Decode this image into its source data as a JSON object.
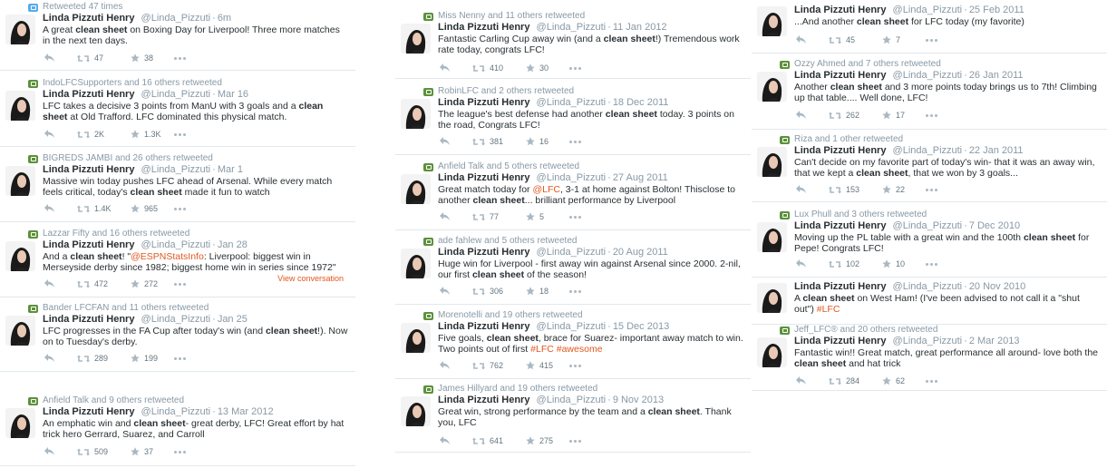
{
  "columns": [
    [
      {
        "rt": "Retweeted 47 times",
        "rtColor": "blue",
        "name": "Linda Pizzuti Henry",
        "handle": "@Linda_Pizzuti",
        "time": "6m",
        "text": [
          [
            "A great ",
            0
          ],
          [
            "clean sheet",
            1
          ],
          [
            " on Boxing Day for Liverpool! Three more matches in the next ten days.",
            0
          ]
        ],
        "retweets": "47",
        "favorites": "38"
      },
      {
        "rt": "IndoLFCSupporters and 16 others retweeted",
        "name": "Linda Pizzuti Henry",
        "handle": "@Linda_Pizzuti",
        "time": "Mar 16",
        "text": [
          [
            "LFC takes a decisive 3 points from ManU with 3 goals and a ",
            0
          ],
          [
            "clean sheet",
            1
          ],
          [
            " at Old Trafford. LFC dominated this physical match.",
            0
          ]
        ],
        "retweets": "2K",
        "favorites": "1.3K"
      },
      {
        "rt": "BIGREDS JAMBI and 26 others retweeted",
        "name": "Linda Pizzuti Henry",
        "handle": "@Linda_Pizzuti",
        "time": "Mar 1",
        "text": [
          [
            "Massive win today pushes LFC ahead of Arsenal. While every match feels critical, today's ",
            0
          ],
          [
            "clean sheet",
            1
          ],
          [
            " made it fun to watch",
            0
          ]
        ],
        "retweets": "1.4K",
        "favorites": "965"
      },
      {
        "rt": "Lazzar Fifty and 16 others retweeted",
        "name": "Linda Pizzuti Henry",
        "handle": "@Linda_Pizzuti",
        "time": "Jan 28",
        "text": [
          [
            "And a ",
            0
          ],
          [
            "clean sheet",
            1
          ],
          [
            "! \"",
            0
          ],
          [
            "@ESPNStatsInfo",
            2
          ],
          [
            ": Liverpool: biggest win in Merseyside derby since 1982; biggest home win in series since 1972\"",
            0
          ]
        ],
        "retweets": "472",
        "favorites": "272",
        "viewConversation": "View conversation"
      },
      {
        "rt": "Bander LFCFAN and 11 others retweeted",
        "name": "Linda Pizzuti Henry",
        "handle": "@Linda_Pizzuti",
        "time": "Jan 25",
        "text": [
          [
            "LFC progresses in the FA Cup after today's win (and ",
            0
          ],
          [
            "clean sheet",
            1
          ],
          [
            "!). Now on to Tuesday's derby.",
            0
          ]
        ],
        "retweets": "289",
        "favorites": "199"
      },
      {
        "rt": "Anfield Talk and 9 others retweeted",
        "name": "Linda Pizzuti Henry",
        "handle": "@Linda_Pizzuti",
        "time": "13 Mar 2012",
        "text": [
          [
            "An emphatic win and ",
            0
          ],
          [
            "clean sheet",
            1
          ],
          [
            "- great derby, LFC! Great effort by hat trick hero Gerrard, Suarez, and Carroll",
            0
          ]
        ],
        "retweets": "509",
        "favorites": "37"
      }
    ],
    [
      {
        "rt": "Miss Nenny and 11 others retweeted",
        "name": "Linda Pizzuti Henry",
        "handle": "@Linda_Pizzuti",
        "time": "11 Jan 2012",
        "text": [
          [
            "Fantastic Carling Cup away win (and a ",
            0
          ],
          [
            "clean sheet",
            1
          ],
          [
            "!) Tremendous work rate today, congrats LFC!",
            0
          ]
        ],
        "retweets": "410",
        "favorites": "30"
      },
      {
        "rt": "RobinLFC and 2 others retweeted",
        "name": "Linda Pizzuti Henry",
        "handle": "@Linda_Pizzuti",
        "time": "18 Dec 2011",
        "text": [
          [
            "The league's best defense had another ",
            0
          ],
          [
            "clean sheet",
            1
          ],
          [
            " today. 3 points on the road, Congrats LFC!",
            0
          ]
        ],
        "retweets": "381",
        "favorites": "16"
      },
      {
        "rt": "Anfield Talk and 5 others retweeted",
        "name": "Linda Pizzuti Henry",
        "handle": "@Linda_Pizzuti",
        "time": "27 Aug 2011",
        "text": [
          [
            "Great match today for ",
            0
          ],
          [
            "@LFC",
            2
          ],
          [
            ", 3-1 at home against Bolton! Thisclose to another ",
            0
          ],
          [
            "clean sheet",
            1
          ],
          [
            "... brilliant performance by Liverpool",
            0
          ]
        ],
        "retweets": "77",
        "favorites": "5"
      },
      {
        "rt": "ade fahlew and 5 others retweeted",
        "name": "Linda Pizzuti Henry",
        "handle": "@Linda_Pizzuti",
        "time": "20 Aug 2011",
        "text": [
          [
            "Huge win for Liverpool - first away win against Arsenal since 2000. 2-nil, our first ",
            0
          ],
          [
            "clean sheet",
            1
          ],
          [
            " of the season!",
            0
          ]
        ],
        "retweets": "306",
        "favorites": "18"
      },
      {
        "rt": "Morenotelli and 19 others retweeted",
        "name": "Linda Pizzuti Henry",
        "handle": "@Linda_Pizzuti",
        "time": "15 Dec 2013",
        "text": [
          [
            "Five goals, ",
            0
          ],
          [
            "clean sheet",
            1
          ],
          [
            ", brace for Suarez- important away match to win. Two points out of first ",
            0
          ],
          [
            "#LFC",
            2
          ],
          [
            " ",
            0
          ],
          [
            "#awesome",
            2
          ]
        ],
        "retweets": "762",
        "favorites": "415"
      },
      {
        "rt": "James Hillyard and 19 others retweeted",
        "name": "Linda Pizzuti Henry",
        "handle": "@Linda_Pizzuti",
        "time": "9 Nov 2013",
        "text": [
          [
            "Great win, strong performance by the team and a ",
            0
          ],
          [
            "clean sheet",
            1
          ],
          [
            ". Thank you, LFC",
            0
          ]
        ],
        "retweets": "641",
        "favorites": "275"
      }
    ],
    [
      {
        "rt": "",
        "name": "Linda Pizzuti Henry",
        "handle": "@Linda_Pizzuti",
        "time": "25 Feb 2011",
        "text": [
          [
            "...And another ",
            0
          ],
          [
            "clean sheet",
            1
          ],
          [
            " for LFC today (my favorite)",
            0
          ]
        ],
        "retweets": "45",
        "favorites": "7"
      },
      {
        "rt": "Ozzy Ahmed and 7 others retweeted",
        "name": "Linda Pizzuti Henry",
        "handle": "@Linda_Pizzuti",
        "time": "26 Jan 2011",
        "text": [
          [
            "Another ",
            0
          ],
          [
            "clean sheet",
            1
          ],
          [
            " and 3 more points today brings us to 7th! Climbing up that table.... Well done, LFC!",
            0
          ]
        ],
        "retweets": "262",
        "favorites": "17"
      },
      {
        "rt": "Riza and 1 other retweeted",
        "name": "Linda Pizzuti Henry",
        "handle": "@Linda_Pizzuti",
        "time": "22 Jan 2011",
        "text": [
          [
            "Can't decide on my favorite part of today's win- that it was an away win, that we kept a ",
            0
          ],
          [
            "clean sheet",
            1
          ],
          [
            ", that we won by 3 goals...",
            0
          ]
        ],
        "retweets": "153",
        "favorites": "22"
      },
      {
        "rt": "Lux Phull and 3 others retweeted",
        "name": "Linda Pizzuti Henry",
        "handle": "@Linda_Pizzuti",
        "time": "7 Dec 2010",
        "text": [
          [
            "Moving up the PL table with a great win and the 100th ",
            0
          ],
          [
            "clean sheet",
            1
          ],
          [
            " for Pepe! Congrats LFC!",
            0
          ]
        ],
        "retweets": "102",
        "favorites": "10"
      },
      {
        "rt": "",
        "name": "Linda Pizzuti Henry",
        "handle": "@Linda_Pizzuti",
        "time": "20 Nov 2010",
        "text": [
          [
            "A ",
            0
          ],
          [
            "clean sheet",
            1
          ],
          [
            " on West Ham! (I've been advised to not call it a \"shut out\") ",
            0
          ],
          [
            "#LFC",
            2
          ]
        ],
        "retweets": "",
        "favorites": ""
      },
      {
        "rt": "Jeff_LFC® and 20 others retweeted",
        "name": "Linda Pizzuti Henry",
        "handle": "@Linda_Pizzuti",
        "time": "2 Mar 2013",
        "text": [
          [
            "Fantastic win!! Great match, great performance all around- love both the ",
            0
          ],
          [
            "clean sheet",
            1
          ],
          [
            " and hat trick",
            0
          ]
        ],
        "retweets": "284",
        "favorites": "62"
      }
    ]
  ]
}
